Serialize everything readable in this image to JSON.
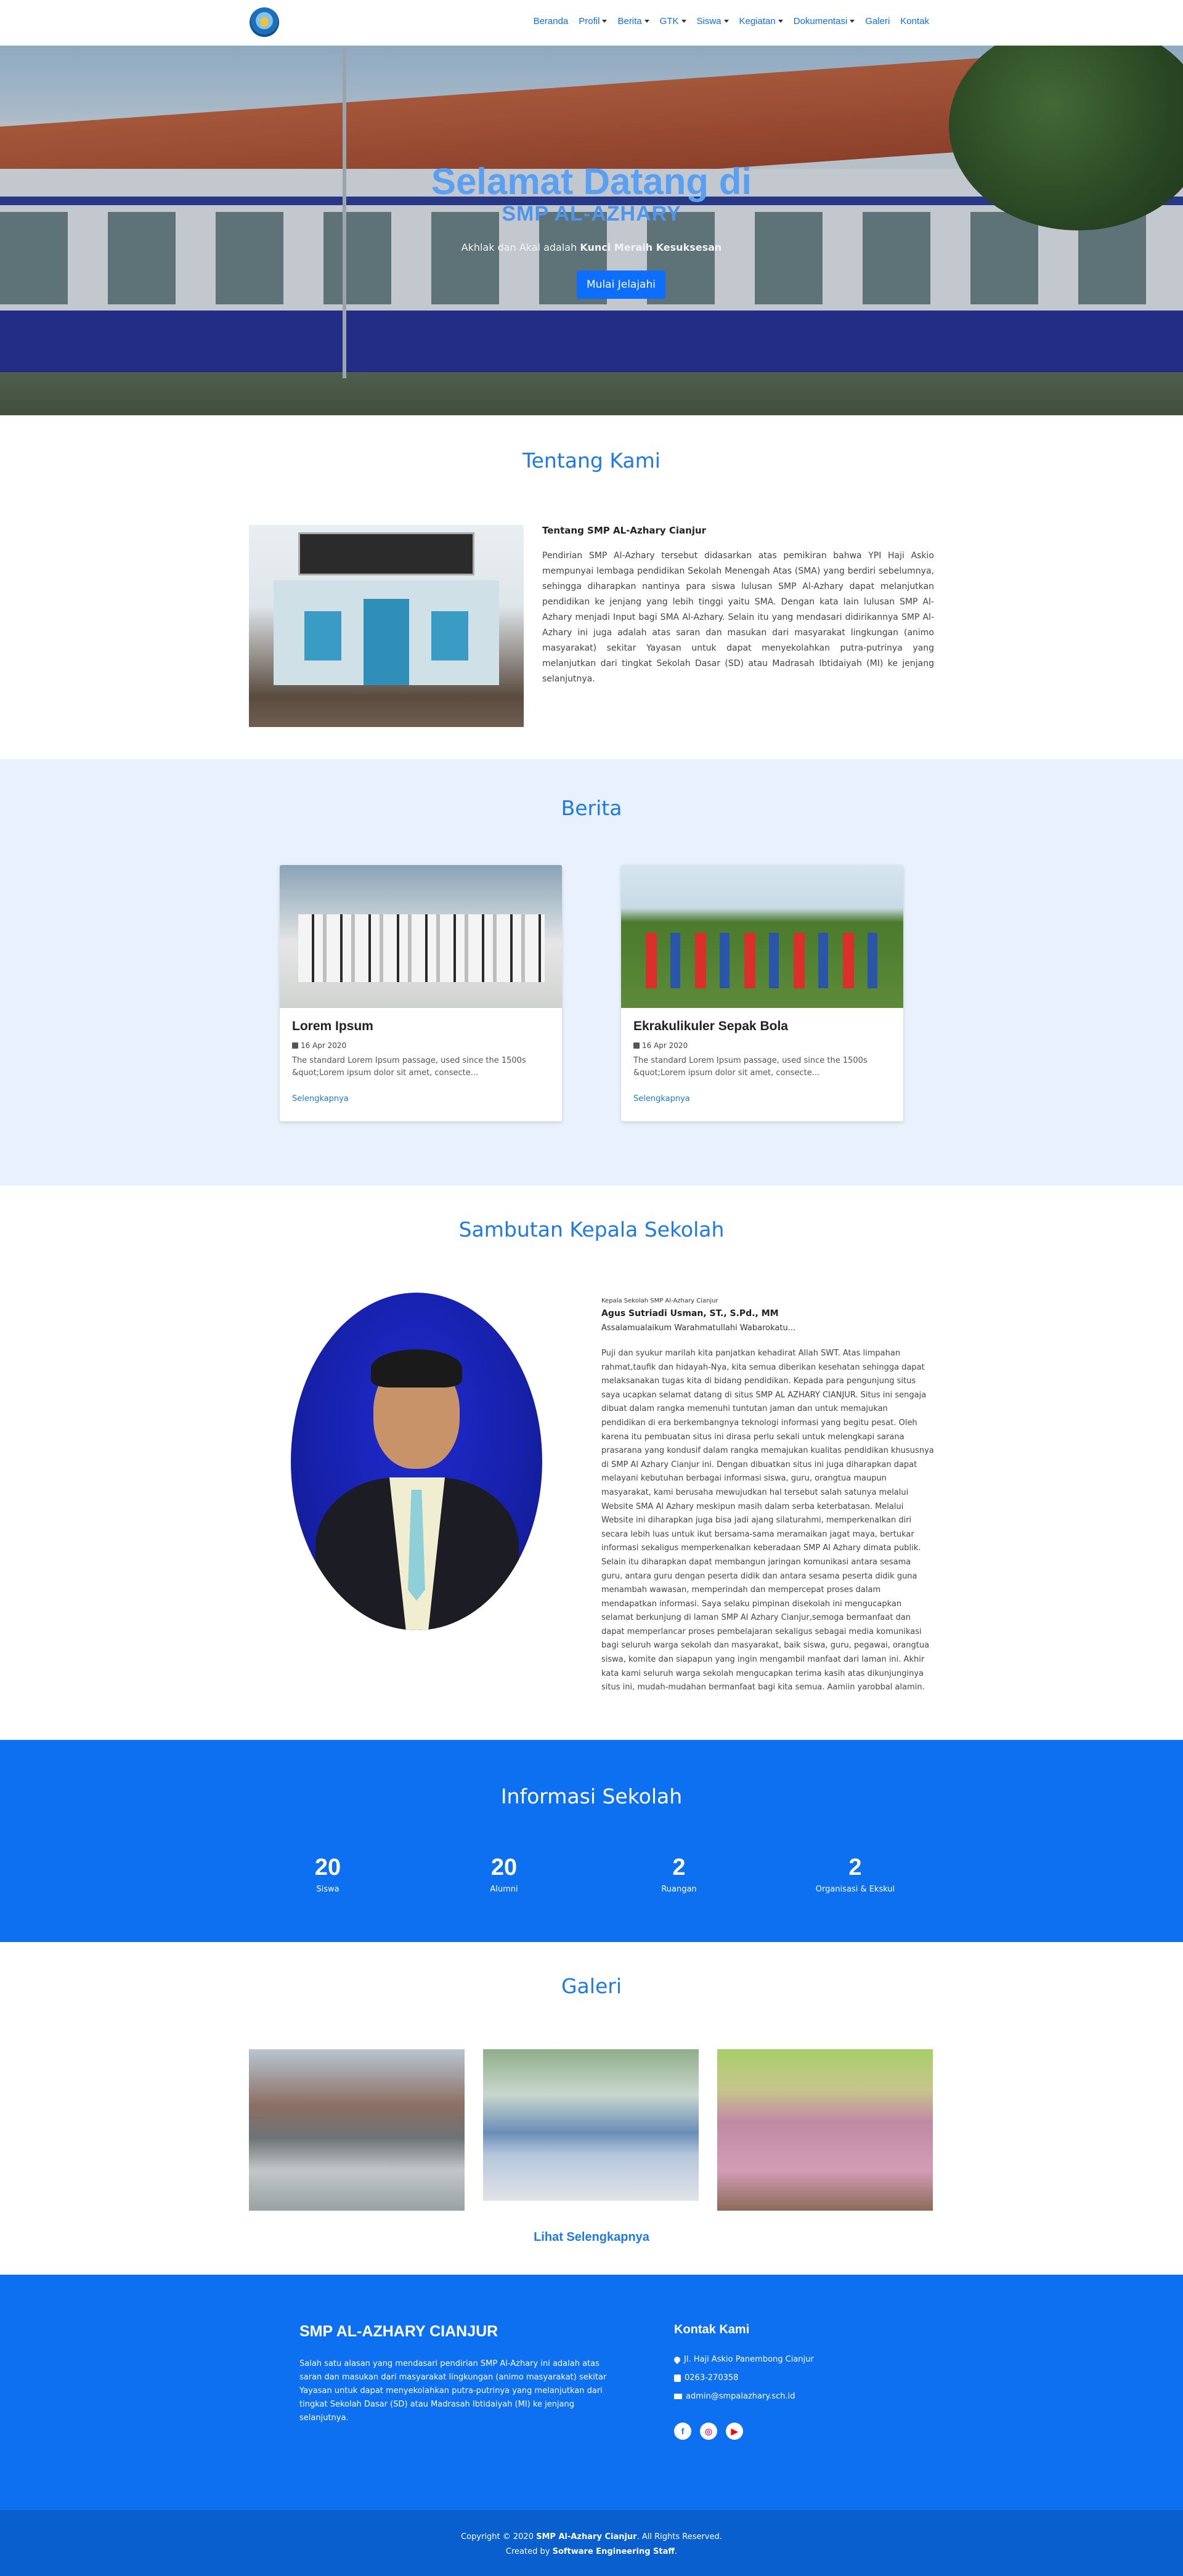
{
  "nav": {
    "items": [
      {
        "label": "Beranda",
        "dropdown": false
      },
      {
        "label": "Profil",
        "dropdown": true
      },
      {
        "label": "Berita",
        "dropdown": true
      },
      {
        "label": "GTK",
        "dropdown": true
      },
      {
        "label": "Siswa",
        "dropdown": true
      },
      {
        "label": "Kegiatan",
        "dropdown": true
      },
      {
        "label": "Dokumentasi",
        "dropdown": true
      },
      {
        "label": "Galeri",
        "dropdown": false
      },
      {
        "label": "Kontak",
        "dropdown": false
      }
    ]
  },
  "hero": {
    "title": "Selamat Datang di",
    "subtitle": "SMP AL-AZHARY",
    "tagline_start": "Akhlak dan Akal adalah ",
    "tagline_bold": "Kunci Meraih Kesuksesan",
    "button": "Mulai Jelajahi"
  },
  "about": {
    "section_title": "Tentang Kami",
    "heading": "Tentang SMP AL-Azhary Cianjur",
    "text": "Pendirian SMP Al-Azhary tersebut didasarkan atas pemikiran bahwa YPI Haji Askio mempunyai lembaga pendidikan Sekolah Menengah Atas (SMA) yang berdiri sebelumnya, sehingga diharapkan nantinya para siswa lulusan SMP Al-Azhary dapat melanjutkan pendidikan ke jenjang yang lebih tinggi yaitu SMA. Dengan kata lain lulusan SMP Al-Azhary menjadi Input bagi SMA Al-Azhary. Selain itu yang mendasari didirikannya SMP Al-Azhary ini juga adalah atas saran dan masukan dari masyarakat lingkungan (animo masyarakat) sekitar Yayasan untuk dapat menyekolahkan putra-putrinya yang melanjutkan dari tingkat Sekolah Dasar (SD) atau Madrasah Ibtidaiyah (MI) ke jenjang selanjutnya."
  },
  "berita": {
    "section_title": "Berita",
    "cards": [
      {
        "title": "Lorem Ipsum",
        "date": "16 Apr 2020",
        "excerpt": "The standard Lorem Ipsum passage, used since the 1500s &quot;Lorem ipsum dolor sit amet, consecte...",
        "link": "Selengkapnya"
      },
      {
        "title": "Ekrakulikuler Sepak Bola",
        "date": "16 Apr 2020",
        "excerpt": "The standard Lorem Ipsum passage, used since the 1500s &quot;Lorem ipsum dolor sit amet, consecte...",
        "link": "Selengkapnya"
      }
    ]
  },
  "sambutan": {
    "section_title": "Sambutan Kepala Sekolah",
    "role": "Kepala Sekolah SMP Al-Azhary Cianjur",
    "name": "Agus Sutriadi Usman, ST., S.Pd., MM",
    "salam": "Assalamualaikum Warahmatullahi Wabarokatu...",
    "text": "Puji dan syukur marilah kita panjatkan kehadirat Allah SWT. Atas limpahan rahmat,taufik dan hidayah-Nya, kita semua diberikan kesehatan sehingga dapat melaksanakan tugas kita di bidang pendidikan. Kepada para pengunjung situs saya ucapkan selamat datang di situs SMP AL AZHARY CIANJUR. Situs ini sengaja dibuat dalam rangka memenuhi tuntutan jaman dan untuk memajukan pendidikan di era berkembangnya teknologi informasi yang begitu pesat. Oleh karena itu pembuatan situs ini dirasa perlu sekali untuk melengkapi sarana prasarana yang kondusif dalam rangka memajukan kualitas pendidikan khususnya di SMP Al Azhary Cianjur ini. Dengan dibuatkan situs ini juga diharapkan dapat melayani kebutuhan berbagai informasi siswa, guru, orangtua maupun masyarakat, kami berusaha mewujudkan hal tersebut salah satunya melalui Website SMA Al Azhary meskipun masih dalam serba keterbatasan. Melalui Website ini diharapkan juga bisa jadi ajang silaturahmi, memperkenalkan diri secara lebih luas untuk ikut bersama-sama meramaikan jagat maya, bertukar informasi sekaligus memperkenalkan keberadaan SMP Al Azhary dimata publik. Selain itu diharapkan dapat membangun jaringan komunikasi antara sesama guru, antara guru dengan peserta didik dan antara sesama peserta didik guna menambah wawasan, memperindah dan mempercepat proses dalam mendapatkan informasi. Saya selaku pimpinan disekolah ini mengucapkan selamat berkunjung di laman SMP Al Azhary Cianjur,semoga bermanfaat dan dapat memperlancar proses pembelajaran sekaligus sebagai media komunikasi bagi seluruh warga sekolah dan masyarakat, baik siswa, guru, pegawai, orangtua siswa, komite dan siapapun yang ingin mengambil manfaat dari laman ini. Akhir kata kami seluruh warga sekolah mengucapkan terima kasih atas dikunjunginya situs ini, mudah-mudahan bermanfaat bagi kita semua. Aamiin yarobbal alamin."
  },
  "info": {
    "section_title": "Informasi Sekolah",
    "stats": [
      {
        "value": "20",
        "label": "Siswa"
      },
      {
        "value": "20",
        "label": "Alumni"
      },
      {
        "value": "2",
        "label": "Ruangan"
      },
      {
        "value": "2",
        "label": "Organisasi & Ekskul"
      }
    ]
  },
  "galeri": {
    "section_title": "Galeri",
    "link": "Lihat Selengkapnya"
  },
  "footer": {
    "title": "SMP AL-AZHARY CIANJUR",
    "text": "Salah satu alasan yang mendasari pendirian SMP Al-Azhary ini adalah atas saran dan masukan dari masyarakat lingkungan (animo masyarakat) sekitar Yayasan untuk dapat menyekolahkan putra-putrinya yang melanjutkan dari tingkat Sekolah Dasar (SD) atau Madrasah Ibtidaiyah (MI) ke jenjang selanjutnya.",
    "kontak_title": "Kontak Kami",
    "address": "Jl. Haji Askio Panembong Cianjur",
    "phone": "0263-270358",
    "email": "admin@smpalazhary.sch.id",
    "social": [
      "facebook-icon",
      "instagram-icon",
      "youtube-icon"
    ],
    "copyright_start": "Copyright © 2020 ",
    "copyright_bold": "SMP Al-Azhary Cianjur",
    "copyright_end": ". All Rights Reserved.",
    "created_start": "Created by ",
    "created_bold": "Software Engineering Staff",
    "created_end": "."
  },
  "colors": {
    "primary": "#0d6efd",
    "section_blue": "#0c70f1",
    "light_blue_bg": "#e8f1fc"
  }
}
